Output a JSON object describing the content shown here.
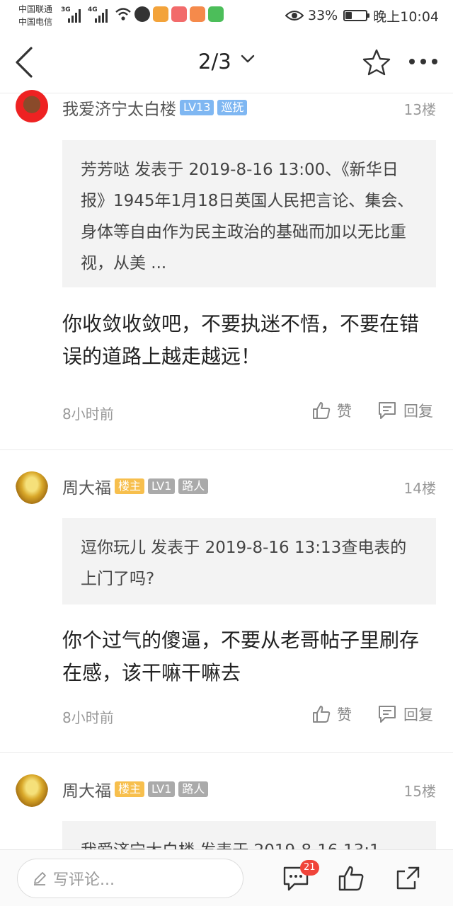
{
  "status_bar": {
    "carrier1": "中国联通",
    "carrier2": "中国电信",
    "net1": "3G",
    "net2": "4G",
    "battery": "33%",
    "battery_level": 0.33,
    "time": "晚上10:04"
  },
  "nav": {
    "page": "2/3",
    "back_icon": "back-icon",
    "star_icon": "star-icon",
    "more_icon": "more-icon"
  },
  "posts": [
    {
      "user": "我爱济宁太白楼",
      "badges": [
        "LV13",
        "巡抚"
      ],
      "floor": "13楼",
      "quote": "芳芳哒 发表于 2019-8-16 13:00、《新华日报》1945年1月18日英国人民把言论、集会、身体等自由作为民主政治的基础而加以无比重视，从美 ...",
      "content": "你收敛收敛吧，不要执迷不悟，不要在错误的道路上越走越远！",
      "time": "8小时前",
      "like": "赞",
      "reply": "回复"
    },
    {
      "user": "周大福",
      "badges": [
        "楼主",
        "LV1",
        "路人"
      ],
      "floor": "14楼",
      "quote": "逗你玩儿 发表于 2019-8-16 13:13查电表的上门了吗?",
      "content": "你个过气的傻逼，不要从老哥帖子里刷存在感，该干嘛干嘛去",
      "time": "8小时前",
      "like": "赞",
      "reply": "回复"
    },
    {
      "user": "周大福",
      "badges": [
        "楼主",
        "LV1",
        "路人"
      ],
      "floor": "15楼",
      "quote": "我爱济宁太白楼 发表于 2019-8-16 13:1"
    }
  ],
  "bottom_bar": {
    "placeholder": "写评论...",
    "comment_count": "21"
  },
  "colors": {
    "badge_blue": "#7fb7f2",
    "badge_orange": "#f7bf4d",
    "badge_gray": "#aaaaaa",
    "count_red": "#f0443a"
  }
}
